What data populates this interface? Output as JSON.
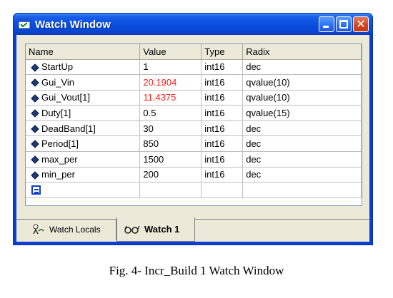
{
  "window": {
    "title": "Watch Window"
  },
  "columns": [
    "Name",
    "Value",
    "Type",
    "Radix"
  ],
  "rows": [
    {
      "name": "StartUp",
      "value": "1",
      "type": "int16",
      "radix": "dec",
      "changed": false
    },
    {
      "name": "Gui_Vin",
      "value": "20.1904",
      "type": "int16",
      "radix": "qvalue(10)",
      "changed": true
    },
    {
      "name": "Gui_Vout[1]",
      "value": "11.4375",
      "type": "int16",
      "radix": "qvalue(10)",
      "changed": true
    },
    {
      "name": "Duty[1]",
      "value": "0.5",
      "type": "int16",
      "radix": "qvalue(15)",
      "changed": false
    },
    {
      "name": "DeadBand[1]",
      "value": "30",
      "type": "int16",
      "radix": "dec",
      "changed": false
    },
    {
      "name": "Period[1]",
      "value": "850",
      "type": "int16",
      "radix": "dec",
      "changed": false
    },
    {
      "name": "max_per",
      "value": "1500",
      "type": "int16",
      "radix": "dec",
      "changed": false
    },
    {
      "name": "min_per",
      "value": "200",
      "type": "int16",
      "radix": "dec",
      "changed": false
    }
  ],
  "tabs": [
    {
      "label": "Watch Locals"
    },
    {
      "label": "Watch 1"
    }
  ],
  "caption": "Fig. 4- Incr_Build 1 Watch Window",
  "colors": {
    "changed_value": "#ff1a1a",
    "title_bar": "#0a4fe0"
  }
}
